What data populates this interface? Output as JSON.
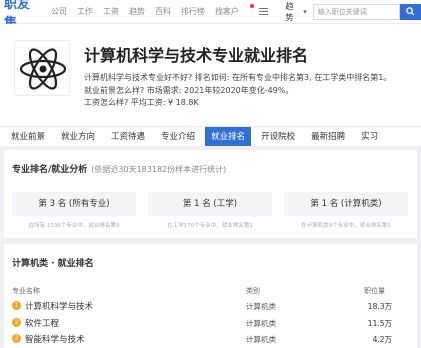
{
  "topbar": {
    "logo": "职友集",
    "nav": [
      "公司",
      "工作",
      "工资",
      "趋势",
      "百科",
      "排行榜",
      "找客户"
    ],
    "dropdown": "趋势",
    "search_placeholder": "输入职位关键词"
  },
  "header": {
    "title": "计算机科学与技术专业就业排名",
    "desc_lines": [
      "计算机科学与技术专业好不好? 排名如何: 在所有专业中排名第3, 在工学类中排名第1。",
      "就业前景怎么样? 市场需求: 2021年较2020年变化-49%。",
      "工资怎么样? 平均工资: ¥ 18.8K"
    ]
  },
  "tabs": [
    {
      "label": "就业前景",
      "active": false
    },
    {
      "label": "就业方向",
      "active": false
    },
    {
      "label": "工资待遇",
      "active": false
    },
    {
      "label": "专业介绍",
      "active": false
    },
    {
      "label": "就业排名",
      "active": true
    },
    {
      "label": "开设院校",
      "active": false
    },
    {
      "label": "最新招聘",
      "active": false
    },
    {
      "label": "实习",
      "active": false
    }
  ],
  "ranking": {
    "title": "专业排名/就业分析",
    "subtitle": "(依据近30天183182份样本进行统计)",
    "boxes": [
      {
        "label": "第 3 名 (所有专业)",
        "note": "在所有 1036个专业中，就业排名第3"
      },
      {
        "label": "第 1 名 (工学)",
        "note": "在工学170个专业中，就业排名第1"
      },
      {
        "label": "第 1 名 (计算机类)",
        "note": "在计算机类9个专业中，就业排名第1"
      }
    ]
  },
  "category": {
    "title": "计算机类 · 就业排名",
    "headers": {
      "name": "专业名称",
      "cat": "类别",
      "count": "职位量"
    },
    "rows": [
      {
        "rank": "1",
        "name": "计算机科学与技术",
        "cat": "计算机类",
        "count": "18.3万"
      },
      {
        "rank": "2",
        "name": "软件工程",
        "cat": "计算机类",
        "count": "11.5万"
      },
      {
        "rank": "3",
        "name": "智能科学与技术",
        "cat": "计算机类",
        "count": "4.2万"
      }
    ]
  },
  "colors": {
    "accent": "#2f6fd6",
    "rank_badge": "#f5a623"
  }
}
